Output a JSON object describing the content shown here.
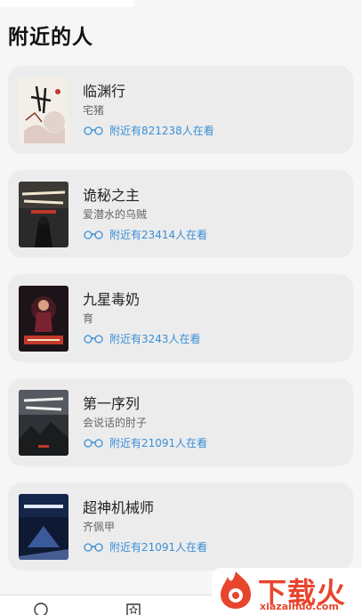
{
  "page": {
    "title": "附近的人"
  },
  "books": [
    {
      "title": "临渊行",
      "author": "宅猪",
      "reading": "附近有821238人在看",
      "cover_icon": "book-cover-linyuanxing"
    },
    {
      "title": "诡秘之主",
      "author": "爱潜水的乌贼",
      "reading": "附近有23414人在看",
      "cover_icon": "book-cover-guimizhizhu"
    },
    {
      "title": "九星毒奶",
      "author": "育",
      "reading": "附近有3243人在看",
      "cover_icon": "book-cover-jiuxingdunai"
    },
    {
      "title": "第一序列",
      "author": "会说话的肘子",
      "reading": "附近有21091人在看",
      "cover_icon": "book-cover-diyixulie"
    },
    {
      "title": "超神机械师",
      "author": "齐佩甲",
      "reading": "附近有21091人在看",
      "cover_icon": "book-cover-chaoshenjixieshi"
    }
  ],
  "tabbar": {
    "icons": [
      "search-icon",
      "bookshelf-icon"
    ]
  },
  "watermark": {
    "name": "下载火",
    "url": "xiazaihuo.com"
  },
  "colors": {
    "accent": "#3a8fd8",
    "card": "#ececec",
    "background": "#f6f6f6",
    "watermark": "#e8452d"
  }
}
